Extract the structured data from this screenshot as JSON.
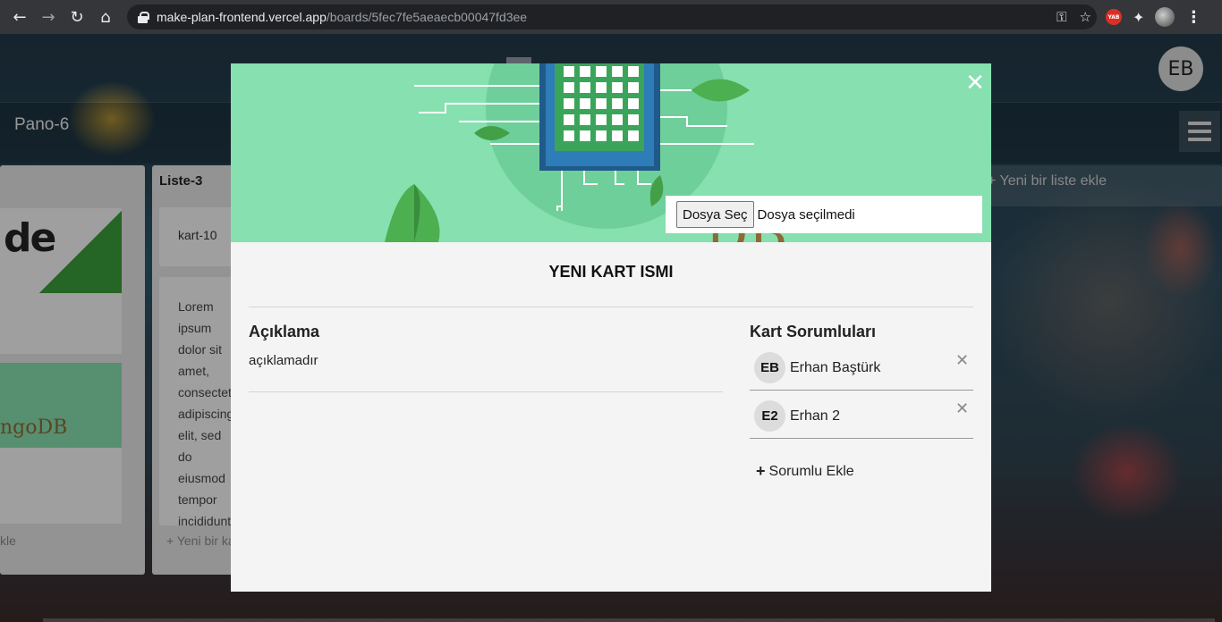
{
  "browser": {
    "url_host": "make-plan-frontend.vercel.app",
    "url_path": "/boards/5fec7fe5aeaecb00047fd3ee",
    "icons": [
      "back-arrow-icon",
      "forward-arrow-icon",
      "reload-icon",
      "home-icon",
      "lock-icon",
      "key-icon",
      "star-icon",
      "puzzle-icon",
      "menu-dots-icon"
    ],
    "extension_badge": "YAB"
  },
  "app": {
    "user_initials": "EB",
    "board_title": "Pano-6",
    "add_list_label": "Yeni bir liste ekle",
    "lists": [
      {
        "title": "Liste-3",
        "cards": [
          {
            "title": "kart-10"
          },
          {
            "title": "Lorem ipsum dolor sit amet, consectetur adipiscing elit, sed do eiusmod tempor incididunt ut labore et dolore magna aliqua. Ut enim ad minim veniam, quis nostrud exercitation ullamco laboris nisi ut aliquip ex ea commodo consequat. Duis aute irure dolor in reprehenderit in voluptate"
          }
        ],
        "add_card_label": "Yeni bir kart ekle"
      }
    ],
    "left_list": {
      "add_card_label": "kle",
      "thumb_node_text": "de",
      "thumb_mongo_text": "ngoDB"
    }
  },
  "modal": {
    "close_icon": "close-icon",
    "file_button_label": "Dosya Seç",
    "file_status": "Dosya seçilmedi",
    "card_name": "YENI KART ISMI",
    "description": {
      "heading": "Açıklama",
      "text": "açıklamadır"
    },
    "assignees": {
      "heading": "Kart Sorumluları",
      "items": [
        {
          "initials": "EB",
          "name": "Erhan Baştürk"
        },
        {
          "initials": "E2",
          "name": "Erhan 2"
        }
      ],
      "add_label": "Sorumlu Ekle"
    }
  },
  "colors": {
    "cover_green": "#86e0b0",
    "chip_green": "#3aa55a",
    "chrome_dark": "#35363a"
  }
}
